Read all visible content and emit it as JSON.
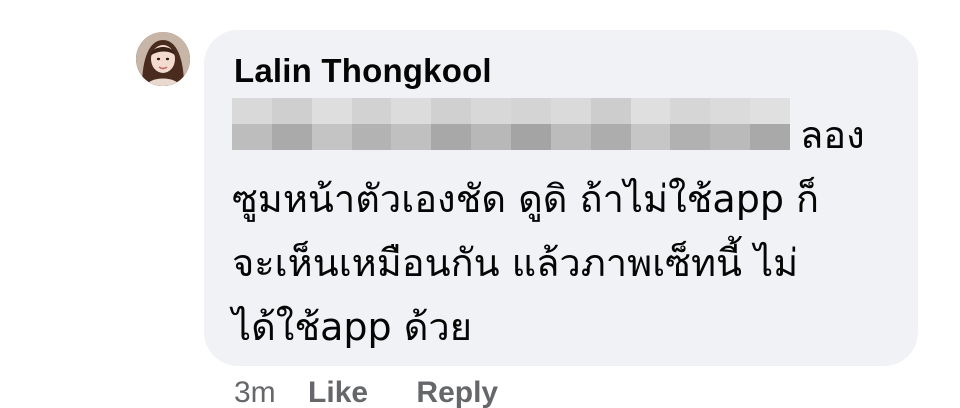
{
  "comment": {
    "author": "Lalin Thongkool",
    "lines": [
      "ลอง",
      "ซูมหน้าตัวเองชัด ดูดิ ถ้าไม่ใช้app ก็",
      "จะเห็นเหมือนกัน  แล้วภาพเซ็ทนี้ ไม่",
      "ได้ใช้app ด้วย"
    ],
    "time": "3m",
    "like_label": "Like",
    "reply_label": "Reply"
  },
  "colors": {
    "bubble_bg": "#f0f2f5",
    "text": "#050505",
    "meta_text": "#65676b"
  },
  "icons": {
    "avatar": "profile-photo"
  }
}
